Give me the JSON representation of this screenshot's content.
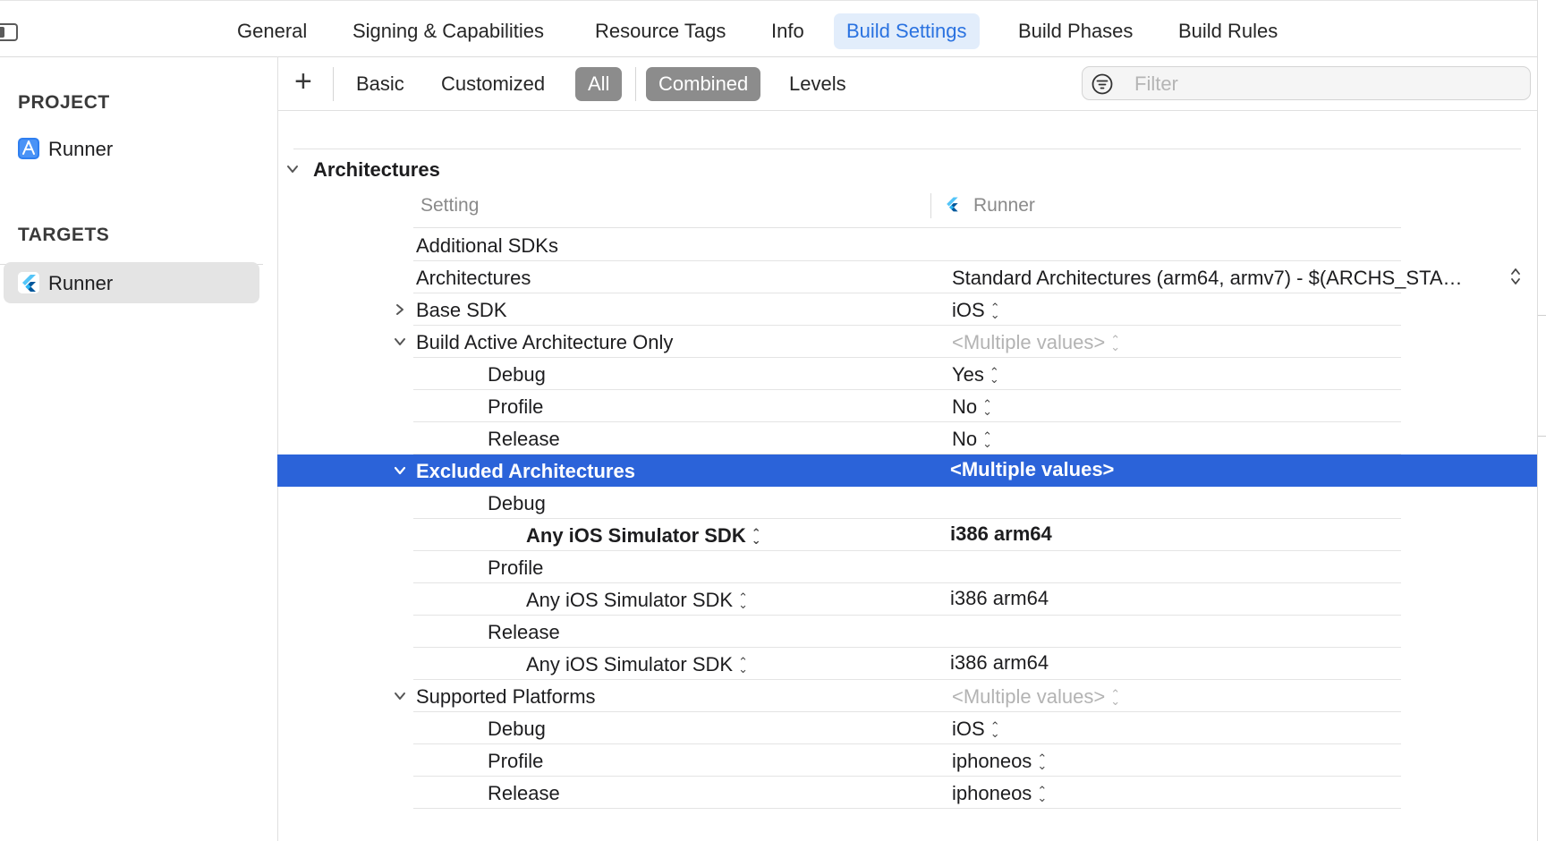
{
  "tabs": [
    {
      "label": "General",
      "active": false
    },
    {
      "label": "Signing & Capabilities",
      "active": false
    },
    {
      "label": "Resource Tags",
      "active": false
    },
    {
      "label": "Info",
      "active": false
    },
    {
      "label": "Build Settings",
      "active": true
    },
    {
      "label": "Build Phases",
      "active": false
    },
    {
      "label": "Build Rules",
      "active": false
    }
  ],
  "sidebar": {
    "project_heading": "PROJECT",
    "project_item": "Runner",
    "targets_heading": "TARGETS",
    "target_item": "Runner"
  },
  "filterbar": {
    "add_label": "+",
    "basic": "Basic",
    "customized": "Customized",
    "all": "All",
    "combined": "Combined",
    "levels": "Levels",
    "filter_placeholder": "Filter",
    "filter_value": ""
  },
  "group": {
    "title": "Architectures",
    "col_setting": "Setting",
    "col_target": "Runner"
  },
  "rows": [
    {
      "name": "Additional SDKs",
      "value": ""
    },
    {
      "name": "Architectures",
      "value": "Standard Architectures (arm64, armv7)  -  $(ARCHS_STA…"
    },
    {
      "name": "Base SDK",
      "value": "iOS"
    },
    {
      "name": "Build Active Architecture Only",
      "value": "<Multiple values>"
    },
    {
      "name": "Debug",
      "value": "Yes"
    },
    {
      "name": "Profile",
      "value": "No"
    },
    {
      "name": "Release",
      "value": "No"
    },
    {
      "name": "Excluded Architectures",
      "value": "<Multiple values>"
    },
    {
      "name": "Debug",
      "value": ""
    },
    {
      "name": "Any iOS Simulator SDK",
      "value": "i386 arm64"
    },
    {
      "name": "Profile",
      "value": ""
    },
    {
      "name": "Any iOS Simulator SDK",
      "value": "i386 arm64"
    },
    {
      "name": "Release",
      "value": ""
    },
    {
      "name": "Any iOS Simulator SDK",
      "value": "i386 arm64"
    },
    {
      "name": "Supported Platforms",
      "value": "<Multiple values>"
    },
    {
      "name": "Debug",
      "value": "iOS"
    },
    {
      "name": "Profile",
      "value": "iphoneos"
    },
    {
      "name": "Release",
      "value": "iphoneos"
    }
  ],
  "colors": {
    "accent": "#2a72e0",
    "selection": "#2b63d9",
    "flutter_light": "#54c5f8",
    "flutter_dark": "#01579b"
  },
  "icons": {
    "sidebar_toggle": "sidebar-toggle-icon",
    "project": "xcode-app-icon",
    "target": "flutter-icon",
    "filter": "filter-lines-icon",
    "disclosure": "chevron-icon",
    "stepper": "up-down-stepper-icon"
  }
}
